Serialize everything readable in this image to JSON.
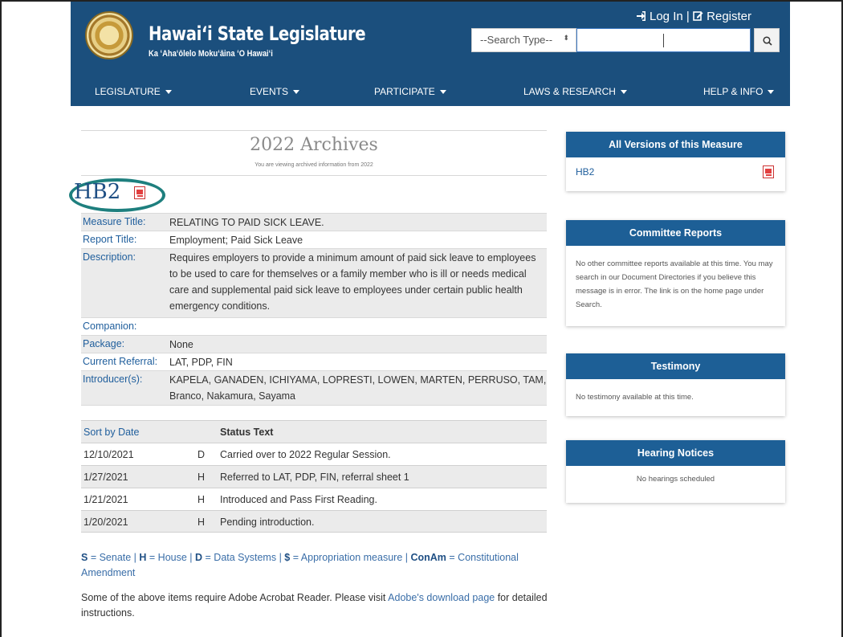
{
  "header": {
    "title": "Hawaiʻi State Legislature",
    "subtitle": "Ka ʻAhaʻōlelo Mokuʻāina ʻO Hawaiʻi",
    "login": "Log In",
    "register": "Register",
    "search_type": "--Search Type--"
  },
  "nav": {
    "items": [
      "LEGISLATURE",
      "EVENTS",
      "PARTICIPATE",
      "LAWS & RESEARCH",
      "HELP & INFO"
    ]
  },
  "archive": {
    "title": "2022 Archives",
    "subtitle": "You are viewing archived information from 2022"
  },
  "measure": {
    "id": "HB2",
    "fields": [
      {
        "label": "Measure Title:",
        "value": "RELATING TO PAID SICK LEAVE."
      },
      {
        "label": "Report Title:",
        "value": "Employment; Paid Sick Leave"
      },
      {
        "label": "Description:",
        "value": "Requires employers to provide a minimum amount of paid sick leave to employees to be used to care for themselves or a family member who is ill or needs medical care and supplemental paid sick leave to employees under certain public health emergency conditions."
      },
      {
        "label": "Companion:",
        "value": ""
      },
      {
        "label": "Package:",
        "value": "None"
      },
      {
        "label": "Current Referral:",
        "value": "LAT, PDP, FIN"
      },
      {
        "label": "Introducer(s):",
        "value": "KAPELA, GANADEN, ICHIYAMA, LOPRESTI, LOWEN, MARTEN, PERRUSO, TAM, Branco, Nakamura, Sayama"
      }
    ]
  },
  "status_table": {
    "col_sort": "Sort by Date",
    "col_status": "Status Text",
    "rows": [
      {
        "date": "12/10/2021",
        "chamber": "D",
        "text": "Carried over to 2022 Regular Session."
      },
      {
        "date": "1/27/2021",
        "chamber": "H",
        "text": "Referred to LAT, PDP, FIN, referral sheet 1"
      },
      {
        "date": "1/21/2021",
        "chamber": "H",
        "text": "Introduced and Pass First Reading."
      },
      {
        "date": "1/20/2021",
        "chamber": "H",
        "text": "Pending introduction."
      }
    ]
  },
  "legend": {
    "s_key": "S",
    "s_text": " = Senate | ",
    "h_key": "H",
    "h_text": " = House | ",
    "d_key": "D",
    "d_text": " = Data Systems | ",
    "dollar_key": "$",
    "dollar_text": " = Appropriation measure | ",
    "conam_key": "ConAm",
    "conam_text": " = Constitutional Amendment"
  },
  "note": {
    "text_before": "Some of the above items require Adobe Acrobat Reader. Please visit ",
    "link": "Adobe's download page",
    "text_after": " for detailed instructions."
  },
  "sidebar": {
    "versions": {
      "title": "All Versions of this Measure",
      "item": "HB2"
    },
    "committee": {
      "title": "Committee Reports",
      "body": "No other committee reports available at this time. You may search in our Document Directories if you believe this message is in error. The link is on the home page under Search."
    },
    "testimony": {
      "title": "Testimony",
      "body": "No testimony available at this time."
    },
    "hearings": {
      "title": "Hearing Notices",
      "body": "No hearings scheduled"
    }
  },
  "colors": {
    "header_bg": "#1b4f7d",
    "card_header": "#1d5f96",
    "link": "#1f5e9c",
    "highlight_circle": "#1e7f7e"
  },
  "icons": [
    "sign-in-icon",
    "edit-icon",
    "search-icon",
    "pdf-icon",
    "chevron-down-icon"
  ]
}
